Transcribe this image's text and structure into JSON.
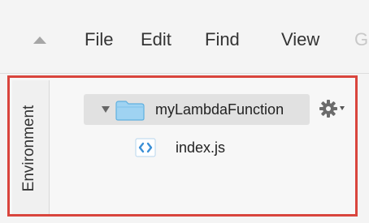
{
  "menubar": {
    "collapse_icon": "triangle-up-icon",
    "items": [
      {
        "label": "File"
      },
      {
        "label": "Edit"
      },
      {
        "label": "Find"
      },
      {
        "label": "View"
      },
      {
        "label": "G"
      }
    ]
  },
  "environment_panel": {
    "tab_label": "Environment",
    "highlight_color": "#d9453d",
    "root": {
      "label": "myLambdaFunction",
      "expanded": true,
      "icon": "folder-icon",
      "settings_icon": "gear-icon"
    },
    "files": [
      {
        "label": "index.js",
        "icon": "js-file-icon"
      }
    ]
  }
}
